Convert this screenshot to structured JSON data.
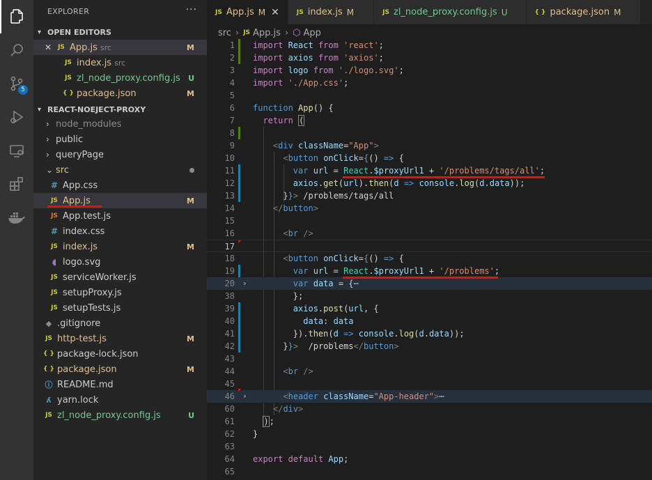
{
  "explorer": {
    "title": "EXPLORER",
    "more": "···",
    "open_editors": {
      "title": "OPEN EDITORS",
      "items": [
        {
          "name": "App.js",
          "folder": "src",
          "status": "M"
        },
        {
          "name": "index.js",
          "folder": "src",
          "status": ""
        },
        {
          "name": "zl_node_proxy.config.js",
          "folder": "",
          "status": "U"
        },
        {
          "name": "package.json",
          "folder": "",
          "status": "M"
        }
      ]
    },
    "project": {
      "title": "REACT-NOEJECT-PROXY",
      "items": [
        {
          "name": "node_modules",
          "status": ""
        },
        {
          "name": "public",
          "status": ""
        },
        {
          "name": "queryPage",
          "status": ""
        },
        {
          "name": "src",
          "status": ""
        },
        {
          "name": "App.css",
          "status": ""
        },
        {
          "name": "App.js",
          "status": "M"
        },
        {
          "name": "App.test.js",
          "status": ""
        },
        {
          "name": "index.css",
          "status": ""
        },
        {
          "name": "index.js",
          "status": "M"
        },
        {
          "name": "logo.svg",
          "status": ""
        },
        {
          "name": "serviceWorker.js",
          "status": ""
        },
        {
          "name": "setupProxy.js",
          "status": ""
        },
        {
          "name": "setupTests.js",
          "status": ""
        },
        {
          "name": ".gitignore",
          "status": ""
        },
        {
          "name": "http-test.js",
          "status": "M"
        },
        {
          "name": "package-lock.json",
          "status": ""
        },
        {
          "name": "package.json",
          "status": "M"
        },
        {
          "name": "README.md",
          "status": ""
        },
        {
          "name": "yarn.lock",
          "status": ""
        },
        {
          "name": "zl_node_proxy.config.js",
          "status": "U"
        }
      ]
    }
  },
  "activity": {
    "scm_badge": "5"
  },
  "icons": {
    "files": "files-icon",
    "search": "search-icon",
    "scm": "source-control-icon",
    "debug": "run-debug-icon",
    "remote": "remote-explorer-icon",
    "extensions": "extensions-icon",
    "docker": "docker-icon"
  },
  "tabs": [
    {
      "label": "App.js",
      "status": "M",
      "close": "✕"
    },
    {
      "label": "index.js",
      "status": "M"
    },
    {
      "label": "zl_node_proxy.config.js",
      "status": "U"
    },
    {
      "label": "package.json",
      "status": "M"
    }
  ],
  "breadcrumb": {
    "folder": "src",
    "file": "App.js",
    "symbol": "App"
  },
  "editor": {
    "line_numbers": [
      "1",
      "2",
      "3",
      "4",
      "5",
      "6",
      "7",
      "8",
      "9",
      "10",
      "11",
      "12",
      "13",
      "14",
      "15",
      "16",
      "17",
      "18",
      "19",
      "20",
      "38",
      "39",
      "40",
      "41",
      "42",
      "43",
      "44",
      "45",
      "46",
      "60",
      "61",
      "62",
      "63",
      "64",
      "65"
    ]
  },
  "colors": {
    "accent_underline": "#e51400",
    "modified": "#e2c08d",
    "untracked": "#73c991",
    "badge": "#0e70c0"
  }
}
